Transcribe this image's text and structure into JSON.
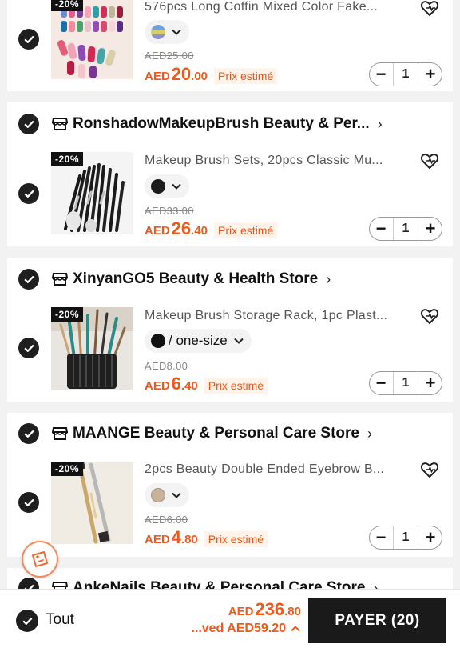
{
  "items": [
    {
      "badge": "-20%",
      "name": "576pcs Long Coffin Mixed Color Fake...",
      "old_price": "AED25.00",
      "cur": "AED",
      "amount": "20",
      "decimal": ".00",
      "estimate": "Prix estimé",
      "qty": "1",
      "swatch": "multicolor"
    },
    {
      "store": "RonshadowMakeupBrush Beauty & Per...",
      "badge": "-20%",
      "name": "Makeup Brush Sets, 20pcs Classic Mu...",
      "old_price": "AED33.00",
      "cur": "AED",
      "amount": "26",
      "decimal": ".40",
      "estimate": "Prix estimé",
      "qty": "1",
      "swatch": "#1c1c1c"
    },
    {
      "store": "XinyanGO5 Beauty & Health Store",
      "badge": "-20%",
      "name": "Makeup Brush Storage Rack, 1pc Plast...",
      "variant_text": "/ one-size",
      "old_price": "AED8.00",
      "cur": "AED",
      "amount": "6",
      "decimal": ".40",
      "estimate": "Prix estimé",
      "qty": "1",
      "swatch": "#111111"
    },
    {
      "store": "MAANGE Beauty & Personal Care Store",
      "badge": "-20%",
      "name": "2pcs Beauty Double Ended Eyebrow B...",
      "old_price": "AED6.00",
      "cur": "AED",
      "amount": "4",
      "decimal": ".80",
      "estimate": "Prix estimé",
      "qty": "1",
      "swatch": "#c9b29a"
    }
  ],
  "next_store": "AnkeNails Beauty & Personal Care Store",
  "footer": {
    "select_all": "Tout",
    "total_cur": "AED",
    "total_amount": "236",
    "total_decimal": ".80",
    "saved": "...ved AED59.20",
    "pay": "PAYER (20)"
  },
  "colors": {
    "accent": "#ef5a1c",
    "dark": "#1a1a1a"
  }
}
